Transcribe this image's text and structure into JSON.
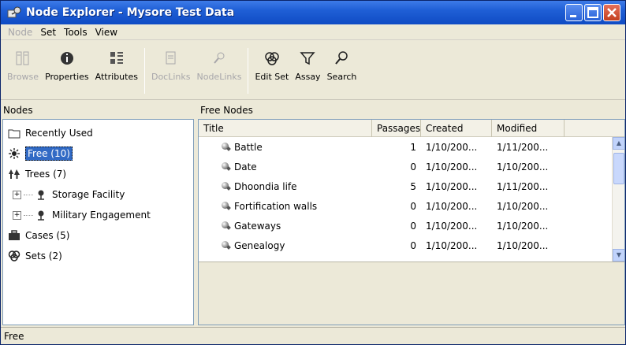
{
  "window": {
    "title": "Node Explorer - Mysore Test Data"
  },
  "menu": [
    {
      "label": "Node",
      "enabled": false
    },
    {
      "label": "Set",
      "enabled": true
    },
    {
      "label": "Tools",
      "enabled": true
    },
    {
      "label": "View",
      "enabled": true
    }
  ],
  "toolbar": {
    "browse": "Browse",
    "properties": "Properties",
    "attributes": "Attributes",
    "doclinks": "DocLinks",
    "nodelinks": "NodeLinks",
    "edit_set": "Edit Set",
    "assay": "Assay",
    "search": "Search"
  },
  "left_pane": {
    "header": "Nodes",
    "items": [
      {
        "label": "Recently Used",
        "icon": "folder-icon"
      },
      {
        "label": "Free (10)",
        "icon": "free-nodes-icon",
        "selected": true
      },
      {
        "label": "Trees (7)",
        "icon": "trees-icon"
      },
      {
        "label": "Storage Facility",
        "icon": "tree-node-icon",
        "expander": "+"
      },
      {
        "label": "Military Engagement",
        "icon": "tree-node-icon",
        "expander": "+"
      },
      {
        "label": "Cases (5)",
        "icon": "cases-icon"
      },
      {
        "label": "Sets (2)",
        "icon": "sets-icon"
      }
    ]
  },
  "right_pane": {
    "header": "Free Nodes",
    "columns": [
      "Title",
      "Passages",
      "Created",
      "Modified"
    ],
    "rows": [
      {
        "title": "Battle",
        "passages": "1",
        "created": "1/10/200...",
        "modified": "1/11/200..."
      },
      {
        "title": "Date",
        "passages": "0",
        "created": "1/10/200...",
        "modified": "1/10/200..."
      },
      {
        "title": "Dhoondia life",
        "passages": "5",
        "created": "1/10/200...",
        "modified": "1/11/200..."
      },
      {
        "title": "Fortification walls",
        "passages": "0",
        "created": "1/10/200...",
        "modified": "1/10/200..."
      },
      {
        "title": "Gateways",
        "passages": "0",
        "created": "1/10/200...",
        "modified": "1/10/200..."
      },
      {
        "title": "Genealogy",
        "passages": "0",
        "created": "1/10/200...",
        "modified": "1/10/200..."
      }
    ]
  },
  "statusbar": {
    "text": "Free"
  },
  "colors": {
    "titlebar": "#1f5fd6",
    "selection": "#316ac5",
    "background": "#ece9d8"
  }
}
